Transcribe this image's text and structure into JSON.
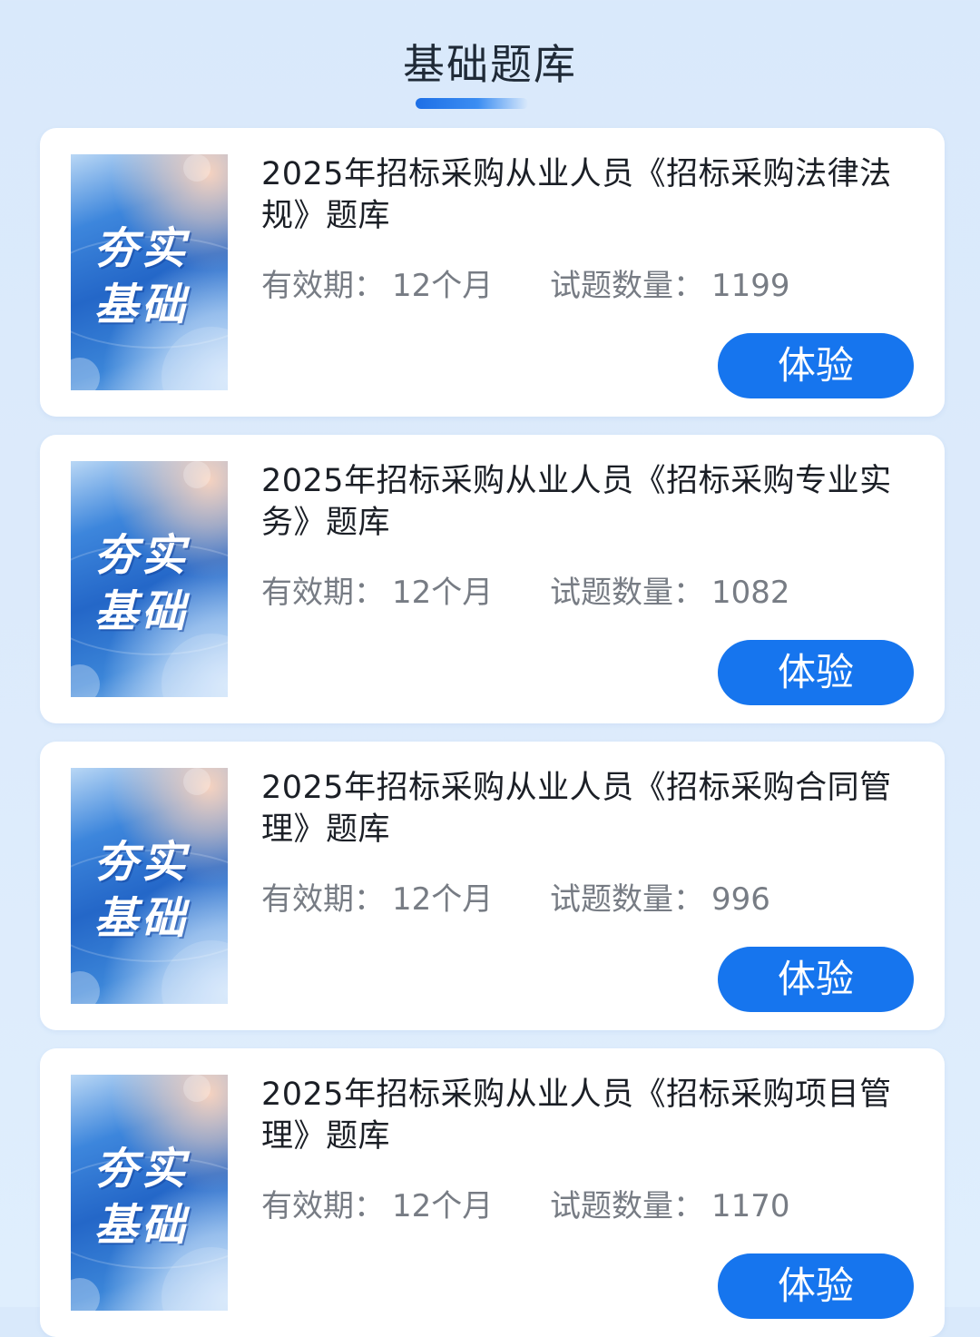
{
  "page": {
    "title": "基础题库"
  },
  "cover": {
    "line1": "夯实",
    "line2": "基础"
  },
  "labels": {
    "validity": "有效期：",
    "count": "试题数量："
  },
  "cards": [
    {
      "title": "2025年招标采购从业人员《招标采购法律法规》题库",
      "validity": "12个月",
      "count": "1199",
      "button": "体验"
    },
    {
      "title": "2025年招标采购从业人员《招标采购专业实务》题库",
      "validity": "12个月",
      "count": "1082",
      "button": "体验"
    },
    {
      "title": "2025年招标采购从业人员《招标采购合同管理》题库",
      "validity": "12个月",
      "count": "996",
      "button": "体验"
    },
    {
      "title": "2025年招标采购从业人员《招标采购项目管理》题库",
      "validity": "12个月",
      "count": "1170",
      "button": "体验"
    }
  ],
  "colors": {
    "accent": "#1675ee",
    "background": "#dceafb",
    "title_text": "#1b1f26",
    "meta_text": "#777c84"
  }
}
